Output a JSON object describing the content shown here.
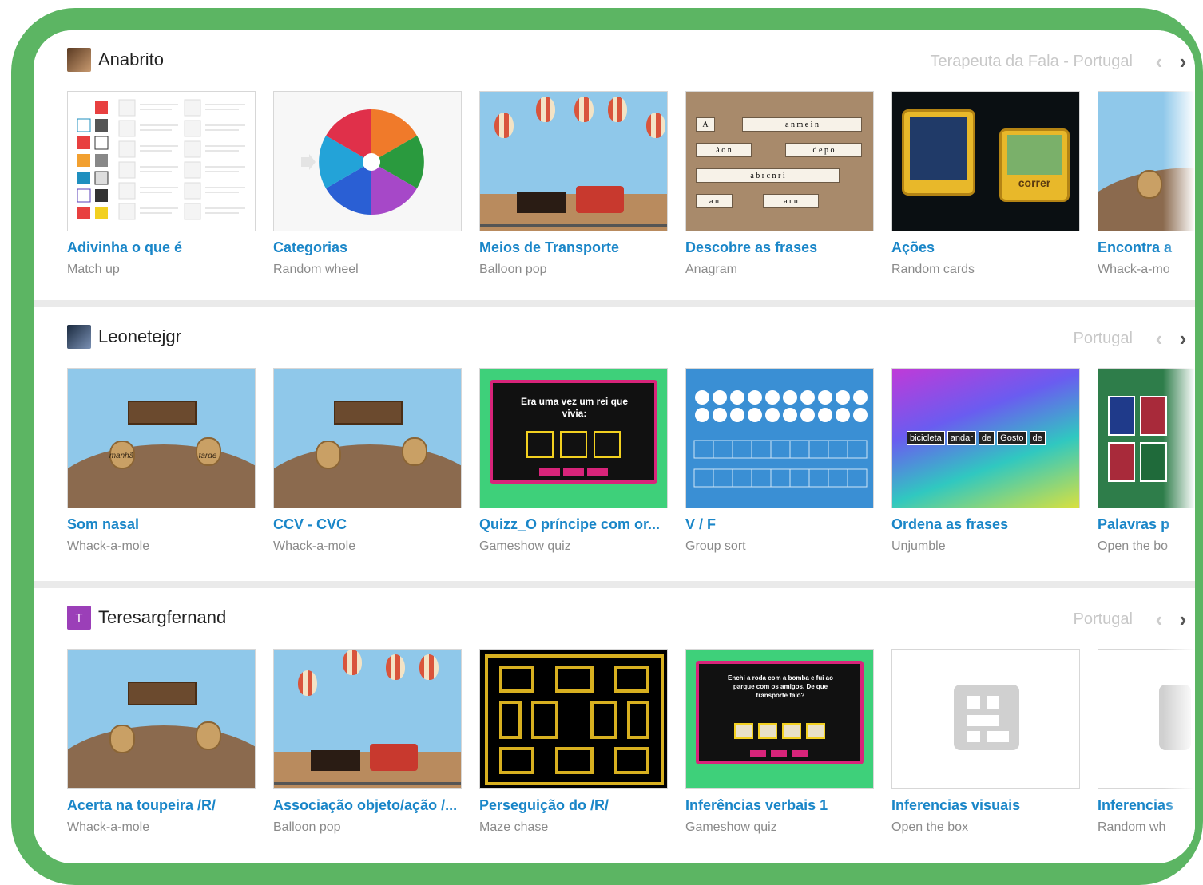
{
  "sections": [
    {
      "owner": "Anabrito",
      "avatar_type": "photo",
      "tagline": "Terapeuta da Fala - Portugal",
      "cards": [
        {
          "title": "Adivinha o que é",
          "subtitle": "Match up",
          "thumb": "match-up"
        },
        {
          "title": "Categorias",
          "subtitle": "Random wheel",
          "thumb": "random-wheel"
        },
        {
          "title": "Meios de Transporte",
          "subtitle": "Balloon pop",
          "thumb": "balloon-pop"
        },
        {
          "title": "Descobre as frases",
          "subtitle": "Anagram",
          "thumb": "anagram"
        },
        {
          "title": "Ações",
          "subtitle": "Random cards",
          "thumb": "random-cards",
          "card_word": "correr"
        },
        {
          "title": "Encontra a",
          "subtitle": "Whack-a-mo",
          "thumb": "whack-a-mole"
        }
      ]
    },
    {
      "owner": "Leonetejgr",
      "avatar_type": "photo",
      "tagline": "Portugal",
      "cards": [
        {
          "title": "Som nasal",
          "subtitle": "Whack-a-mole",
          "thumb": "whack-a-mole",
          "mole_labels": [
            "manhã",
            "tarde"
          ]
        },
        {
          "title": "CCV - CVC",
          "subtitle": "Whack-a-mole",
          "thumb": "whack-a-mole"
        },
        {
          "title": "Quizz_O príncipe com or...",
          "subtitle": "Gameshow quiz",
          "thumb": "gameshow",
          "quiz_text": "Era uma vez um rei que vivia:"
        },
        {
          "title": "V / F",
          "subtitle": "Group sort",
          "thumb": "group-sort"
        },
        {
          "title": "Ordena as frases",
          "subtitle": "Unjumble",
          "thumb": "unjumble",
          "words": [
            "bicicleta",
            "andar",
            "de",
            "Gosto",
            "de"
          ]
        },
        {
          "title": "Palavras p",
          "subtitle": "Open the bo",
          "thumb": "open-box-cards"
        }
      ]
    },
    {
      "owner": "Teresargfernand",
      "avatar_type": "letter",
      "avatar_letter": "T",
      "avatar_color": "#9b3fb8",
      "tagline": "Portugal",
      "cards": [
        {
          "title": "Acerta na toupeira /R/",
          "subtitle": "Whack-a-mole",
          "thumb": "whack-a-mole"
        },
        {
          "title": "Associação objeto/ação /...",
          "subtitle": "Balloon pop",
          "thumb": "balloon-pop"
        },
        {
          "title": "Perseguição do /R/",
          "subtitle": "Maze chase",
          "thumb": "maze-chase"
        },
        {
          "title": "Inferências verbais 1",
          "subtitle": "Gameshow quiz",
          "thumb": "gameshow",
          "quiz_text": "Enchi a roda com a bomba e fui ao parque com os amigos. De que transporte falo?"
        },
        {
          "title": "Inferencias visuais",
          "subtitle": "Open the box",
          "thumb": "placeholder"
        },
        {
          "title": "Inferencias",
          "subtitle": "Random wh",
          "thumb": "placeholder"
        }
      ]
    }
  ],
  "colors": {
    "frame": "#5cb563",
    "title_link": "#1a86c8",
    "subtitle": "#8a8a8a",
    "tagline": "#c8c8c8"
  }
}
